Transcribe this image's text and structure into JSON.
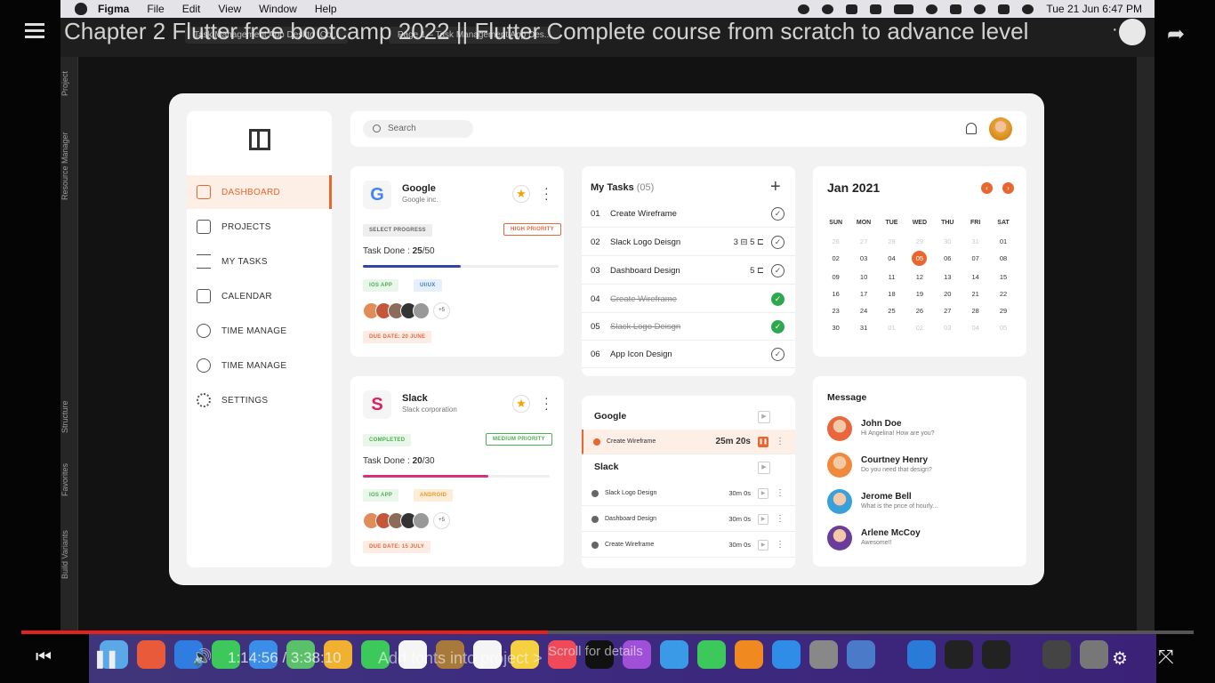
{
  "menubar": {
    "app": "Figma",
    "items": [
      "File",
      "Edit",
      "View",
      "Window",
      "Help"
    ],
    "clock": "Tue 21 Jun  6:47 PM"
  },
  "video": {
    "title": "Chapter 2 Flutter free bootcamp 2022 || Flutter Complete course from scratch to advance level",
    "time": "1:14:56 / 3:38:10",
    "chapter": "Add fonts into project",
    "chapter_arrow": ">",
    "scroll_hint": "Scroll for details"
  },
  "figma": {
    "tabs": [
      "Task Management App Deskto (Co...",
      "Page 1 – Task Management App Des..."
    ],
    "side_labels": [
      "Project",
      "Resource Manager",
      "Structure",
      "Favorites",
      "Build Variants"
    ]
  },
  "search": {
    "placeholder": "Search"
  },
  "sidebar": {
    "items": [
      {
        "label": "DASHBOARD",
        "icon": "grid-icon"
      },
      {
        "label": "PROJECTS",
        "icon": "briefcase-icon"
      },
      {
        "label": "MY TASKS",
        "icon": "list-icon"
      },
      {
        "label": "CALENDAR",
        "icon": "calendar-icon"
      },
      {
        "label": "TIME MANAGE",
        "icon": "check-circle-icon"
      },
      {
        "label": "TIME MANAGE",
        "icon": "pie-chart-icon"
      },
      {
        "label": "SETTINGS",
        "icon": "gear-icon"
      }
    ]
  },
  "projects": [
    {
      "name": "Google",
      "company": "Google inc.",
      "logo_letter": "G",
      "status_tag": "SELECT PROGRESS",
      "priority_tag": "HIGH PRIORITY",
      "task_done_label": "Task Done :",
      "task_done_value": "25",
      "task_total": "/50",
      "progress": 0.5,
      "bar_color": "#3346a8",
      "tags": [
        "IOS APP",
        "UI/UX"
      ],
      "more": "+5",
      "due": "DUE DATE: 20 JUNE"
    },
    {
      "name": "Slack",
      "company": "Slack corporation",
      "logo_letter": "S",
      "status_tag": "COMPLETED",
      "priority_tag": "MEDIUM PRIORITY",
      "task_done_label": "Task Done :",
      "task_done_value": "20",
      "task_total": "/30",
      "progress": 0.67,
      "bar_color": "#d9307a",
      "tags": [
        "IOS APP",
        "ANDROID"
      ],
      "more": "+5",
      "due": "DUE DATE: 15 JULY"
    }
  ],
  "tasks": {
    "title": "My Tasks",
    "count": "(05)",
    "add": "+",
    "items": [
      {
        "num": "01",
        "name": "Create Wireframe",
        "meta": "",
        "done": false
      },
      {
        "num": "02",
        "name": "Slack Logo Deisgn",
        "meta": "3 ⊟   5 ⊏",
        "done": false
      },
      {
        "num": "03",
        "name": "Dashboard Design",
        "meta": "5 ⊏",
        "done": false
      },
      {
        "num": "04",
        "name": "Create Wireframe",
        "meta": "",
        "done": true
      },
      {
        "num": "05",
        "name": "Slack Logo Deisgn",
        "meta": "",
        "done": true
      },
      {
        "num": "06",
        "name": "App Icon Design",
        "meta": "",
        "done": false
      }
    ]
  },
  "calendar": {
    "title": "Jan 2021",
    "prev": "‹",
    "next": "›",
    "days": [
      "SUN",
      "MON",
      "TUE",
      "WED",
      "THU",
      "FRI",
      "SAT"
    ],
    "cells": [
      {
        "d": "26",
        "m": true
      },
      {
        "d": "27",
        "m": true
      },
      {
        "d": "28",
        "m": true
      },
      {
        "d": "29",
        "m": true
      },
      {
        "d": "30",
        "m": true
      },
      {
        "d": "31",
        "m": true
      },
      {
        "d": "01"
      },
      {
        "d": "02"
      },
      {
        "d": "03"
      },
      {
        "d": "04"
      },
      {
        "d": "05",
        "today": true
      },
      {
        "d": "06"
      },
      {
        "d": "07"
      },
      {
        "d": "08"
      },
      {
        "d": "09"
      },
      {
        "d": "10"
      },
      {
        "d": "11"
      },
      {
        "d": "12"
      },
      {
        "d": "13"
      },
      {
        "d": "14"
      },
      {
        "d": "15"
      },
      {
        "d": "16"
      },
      {
        "d": "17"
      },
      {
        "d": "18"
      },
      {
        "d": "19"
      },
      {
        "d": "20"
      },
      {
        "d": "21"
      },
      {
        "d": "22"
      },
      {
        "d": "23"
      },
      {
        "d": "24"
      },
      {
        "d": "25"
      },
      {
        "d": "26"
      },
      {
        "d": "27"
      },
      {
        "d": "28"
      },
      {
        "d": "29"
      },
      {
        "d": "30"
      },
      {
        "d": "31"
      },
      {
        "d": "01",
        "m": true
      },
      {
        "d": "02",
        "m": true
      },
      {
        "d": "03",
        "m": true
      },
      {
        "d": "04",
        "m": true
      },
      {
        "d": "05",
        "m": true
      }
    ]
  },
  "timetracker": {
    "groups": [
      {
        "name": "Google",
        "rows": [
          {
            "name": "Create Wireframe",
            "time": "25m 20s",
            "active": true
          }
        ]
      },
      {
        "name": "Slack",
        "rows": [
          {
            "name": "Slack Logo Design",
            "time": "30m 0s",
            "active": false
          },
          {
            "name": "Dashboard Design",
            "time": "30m 0s",
            "active": false
          },
          {
            "name": "Create Wireframe",
            "time": "30m 0s",
            "active": false
          }
        ]
      }
    ]
  },
  "messages": {
    "title": "Message",
    "items": [
      {
        "name": "John Doe",
        "text": "Hi Angelina! How are you?",
        "color": "#e8673f"
      },
      {
        "name": "Courtney Henry",
        "text": "Do you need that design?",
        "color": "#f08a3a"
      },
      {
        "name": "Jerome Bell",
        "text": "What is the price of hourly...",
        "color": "#3aa0d8"
      },
      {
        "name": "Arlene McCoy",
        "text": "Awesome!!",
        "color": "#6a3d9a"
      }
    ]
  },
  "colors": {
    "accent": "#e8672f",
    "app_bg": "#f2f2f2"
  }
}
